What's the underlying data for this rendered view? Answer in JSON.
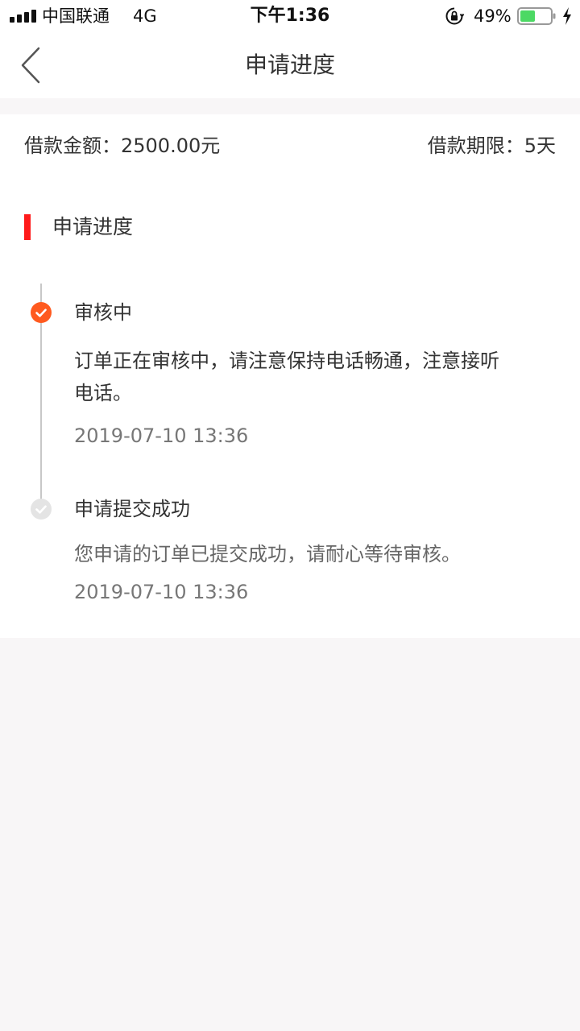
{
  "status_bar": {
    "carrier": "中国联通",
    "network": "4G",
    "time": "下午1:36",
    "battery_percent": "49%",
    "battery_level": 0.49,
    "icons": [
      "signal-icon",
      "orientation-lock-icon",
      "battery-icon",
      "charging-bolt-icon"
    ]
  },
  "nav": {
    "title": "申请进度",
    "back_icon": "chevron-left-icon"
  },
  "loan": {
    "amount_label": "借款金额：2500.00元",
    "term_label": "借款期限：5天"
  },
  "progress": {
    "section_title": "申请进度",
    "steps": [
      {
        "title": "审核中",
        "description": "订单正在审核中，请注意保持电话畅通，注意接听电话。",
        "time": "2019-07-10 13:36",
        "state": "active",
        "icon": "check-circle-icon"
      },
      {
        "title": "申请提交成功",
        "description": "您申请的订单已提交成功，请耐心等待审核。",
        "time": "2019-07-10 13:36",
        "state": "done",
        "icon": "check-circle-icon"
      }
    ]
  },
  "colors": {
    "accent": "#ff5a1f",
    "section_marker": "#ff1a1a",
    "inactive_dot": "#e4e4e4",
    "battery_fill": "#4cd964",
    "page_background": "#f8f6f7"
  }
}
